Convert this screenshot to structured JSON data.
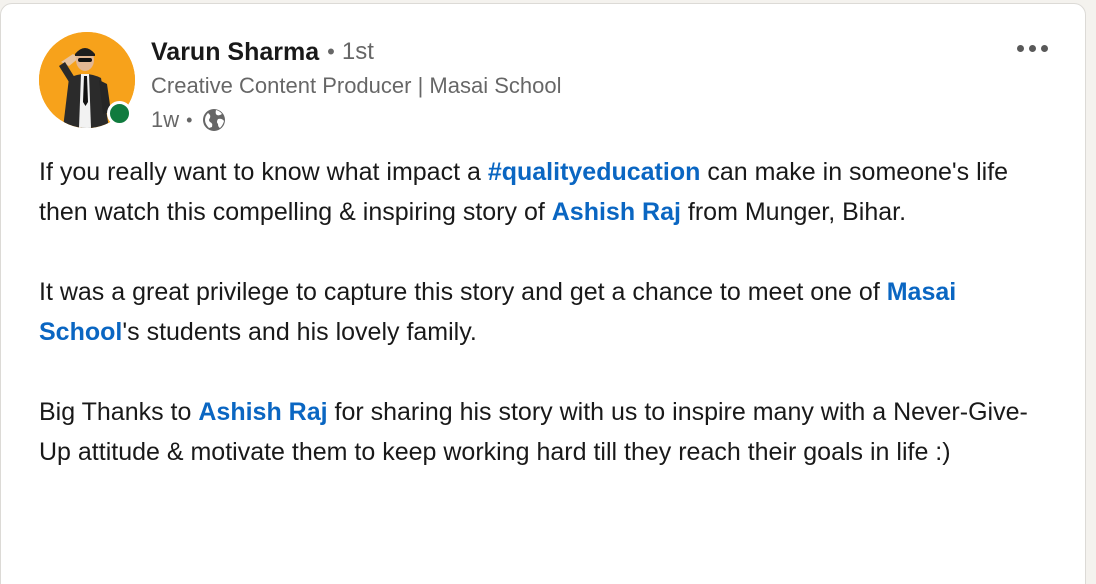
{
  "author": {
    "name": "Varun Sharma",
    "separator": "•",
    "degree": "1st",
    "headline": "Creative Content Producer | Masai School",
    "time": "1w",
    "visibility_icon": "globe-icon",
    "online_status": "online"
  },
  "colors": {
    "link": "#0a66c2",
    "avatar_bg": "#f7a21b",
    "presence": "#107b3e"
  },
  "post": {
    "p1": {
      "t1": "If you really want to know what impact a ",
      "hashtag": "#qualityeducation",
      "t2": " can make in someone's life then watch this compelling & inspiring story of ",
      "mention": "Ashish Raj",
      "t3": " from Munger, Bihar."
    },
    "p2": {
      "t1": "It was a great privilege to capture this story and get a chance to meet one of ",
      "mention": "Masai School",
      "t2": "'s students and his lovely family."
    },
    "p3": {
      "t1": "Big Thanks to ",
      "mention": "Ashish Raj",
      "t2": " for sharing his story with us to inspire many with a Never-Give-Up attitude & motivate them to keep working hard till they reach their goals in life :)"
    }
  }
}
